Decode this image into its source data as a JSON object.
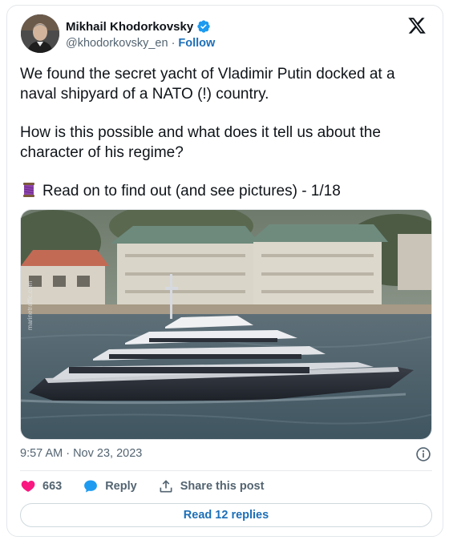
{
  "author": {
    "display_name": "Mikhail Khodorkovsky",
    "handle": "@khodorkovsky_en",
    "separator": "·",
    "follow_label": "Follow"
  },
  "tweet": {
    "paragraphs": [
      "We found the secret yacht of Vladimir Putin docked at a naval shipyard of a NATO (!) country.",
      " How is this possible and what does it tell us about the character of his regime?",
      "Read on to find out (and see pictures) - 1/18"
    ],
    "emoji_icon": "thread-spool-icon"
  },
  "media": {
    "description_icon": "yacht-photo",
    "watermark": "marinetraffic.com"
  },
  "meta": {
    "timestamp": "9:57 AM · Nov 23, 2023"
  },
  "actions": {
    "like_count": "663",
    "reply_label": "Reply",
    "share_label": "Share this post"
  },
  "replies_button": "Read 12 replies",
  "colors": {
    "link_blue": "#1d6fb8",
    "like_pink": "#f91880",
    "reply_blue": "#1d9bf0",
    "verified_blue": "#1d9bf0",
    "muted": "#536471"
  }
}
